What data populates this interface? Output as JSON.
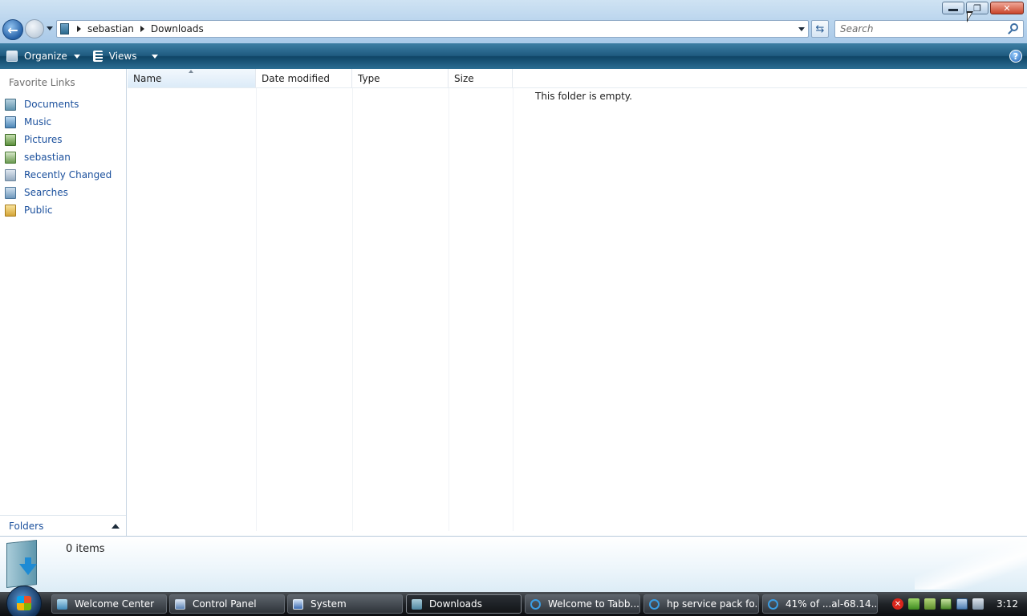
{
  "window": {
    "breadcrumb": [
      "sebastian",
      "Downloads"
    ],
    "search_placeholder": "Search",
    "controls": {
      "minimize": "minimize",
      "maximize": "maximize",
      "close": "close"
    }
  },
  "toolbar": {
    "organize_label": "Organize",
    "views_label": "Views",
    "help_glyph": "?"
  },
  "navpane": {
    "title": "Favorite Links",
    "links": [
      {
        "label": "Documents",
        "icon": "documents-icon"
      },
      {
        "label": "Music",
        "icon": "music-icon"
      },
      {
        "label": "Pictures",
        "icon": "pictures-icon"
      },
      {
        "label": "sebastian",
        "icon": "user-folder-icon"
      },
      {
        "label": "Recently Changed",
        "icon": "recently-changed-icon"
      },
      {
        "label": "Searches",
        "icon": "searches-icon"
      },
      {
        "label": "Public",
        "icon": "public-folder-icon"
      }
    ],
    "folders_label": "Folders"
  },
  "filelist": {
    "columns": [
      "Name",
      "Date modified",
      "Type",
      "Size"
    ],
    "sorted_column": "Name",
    "empty_message": "This folder is empty."
  },
  "details": {
    "items_count": "0 items"
  },
  "taskbar": {
    "tasks": [
      {
        "label": "Welcome Center",
        "icon": "welcome-center-icon",
        "active": false
      },
      {
        "label": "Control Panel",
        "icon": "control-panel-icon",
        "active": false
      },
      {
        "label": "System",
        "icon": "system-icon",
        "active": false
      },
      {
        "label": "Downloads",
        "icon": "folder-icon",
        "active": true
      },
      {
        "label": "Welcome to Tabb...",
        "icon": "internet-explorer-icon",
        "active": false
      },
      {
        "label": "hp service pack fo...",
        "icon": "internet-explorer-icon",
        "active": false
      },
      {
        "label": "41% of ...al-68.14....",
        "icon": "internet-explorer-icon",
        "active": false
      }
    ],
    "clock": "3:12"
  },
  "colors": {
    "link_blue": "#1a4f9c",
    "commandbar_dark": "#0f4566",
    "taskbar_dark": "#0b0d10"
  }
}
